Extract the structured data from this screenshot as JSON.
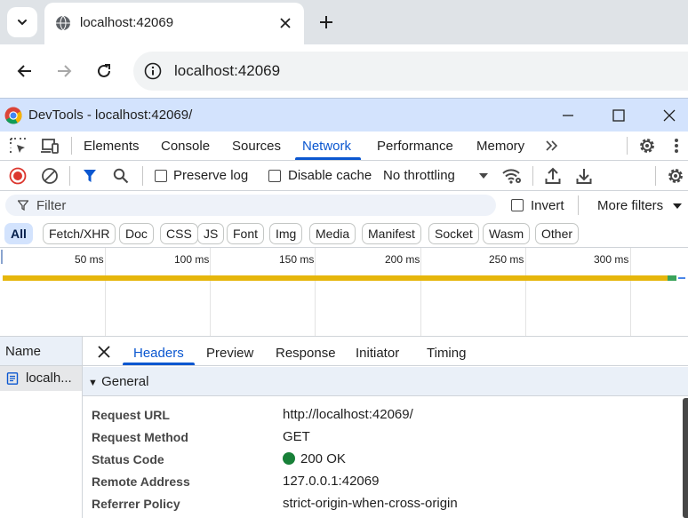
{
  "browser": {
    "tab": {
      "title": "localhost:42069"
    },
    "address": "localhost:42069"
  },
  "devtools": {
    "window_title": "DevTools - localhost:42069/",
    "tabs": [
      "Elements",
      "Console",
      "Sources",
      "Network",
      "Performance",
      "Memory"
    ],
    "active_tab": "Network",
    "toolbar": {
      "preserve_log": "Preserve log",
      "disable_cache": "Disable cache",
      "throttling": "No throttling"
    },
    "filter": {
      "placeholder": "Filter",
      "invert": "Invert",
      "more_filters": "More filters"
    },
    "type_filters": [
      "All",
      "Fetch/XHR",
      "Doc",
      "CSS",
      "JS",
      "Font",
      "Img",
      "Media",
      "Manifest",
      "Socket",
      "Wasm",
      "Other"
    ],
    "active_type_filter": "All",
    "timeline": {
      "ticks": [
        "50 ms",
        "100 ms",
        "150 ms",
        "200 ms",
        "250 ms",
        "300 ms"
      ]
    },
    "requests": {
      "column": "Name",
      "items": [
        "localh..."
      ]
    },
    "details": {
      "tabs": [
        "Headers",
        "Preview",
        "Response",
        "Initiator",
        "Timing"
      ],
      "active_tab": "Headers",
      "section": "General",
      "headers": [
        {
          "key": "Request URL",
          "value": "http://localhost:42069/"
        },
        {
          "key": "Request Method",
          "value": "GET"
        },
        {
          "key": "Status Code",
          "value": "200 OK"
        },
        {
          "key": "Remote Address",
          "value": "127.0.0.1:42069"
        },
        {
          "key": "Referrer Policy",
          "value": "strict-origin-when-cross-origin"
        }
      ]
    }
  },
  "colors": {
    "accent": "#0b57d0",
    "devtools_titlebar": "#d3e3fd",
    "status_ok": "#188038",
    "waterfall_bar": "#e6b60c"
  }
}
